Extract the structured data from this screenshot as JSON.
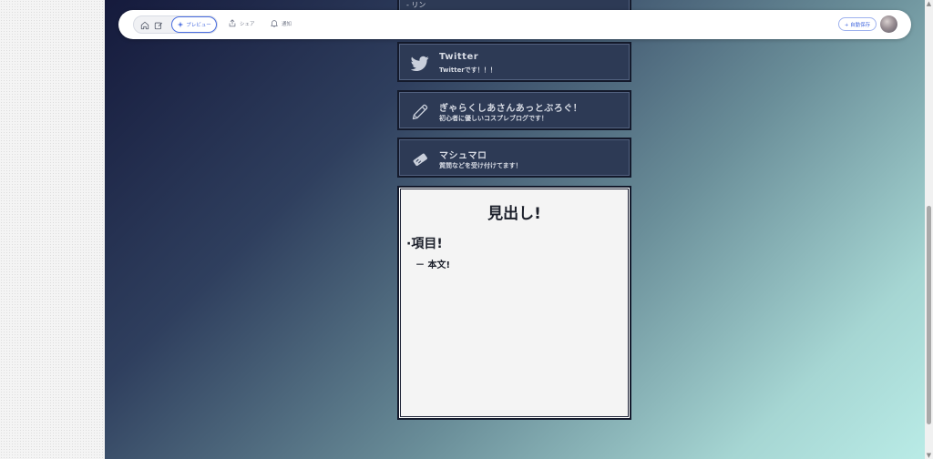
{
  "toolbar": {
    "preview_label": "プレビュー",
    "share_label": "シェア",
    "notify_label": "通知",
    "follow_label": "+ 自動保存"
  },
  "links": [
    {
      "title": "Twitter",
      "description": "Twitterです！！！",
      "icon": "twitter-icon"
    },
    {
      "title": "ぎゃらくしあさんあっとぶろぐ！",
      "description": "初心者に優しいコスプレブログです！",
      "icon": "pencil-icon"
    },
    {
      "title": "マシュマロ",
      "description": "質問などを受け付けてます！",
      "icon": "marshmallow-icon"
    }
  ],
  "top_fragment": "- リン",
  "panel": {
    "heading": "見出し!",
    "item": "·項目!",
    "body": "－ 本文!"
  },
  "colors": {
    "accent": "#4a6ee0",
    "card_bg": "#2d3a55",
    "panel_bg": "#f4f4f4"
  }
}
